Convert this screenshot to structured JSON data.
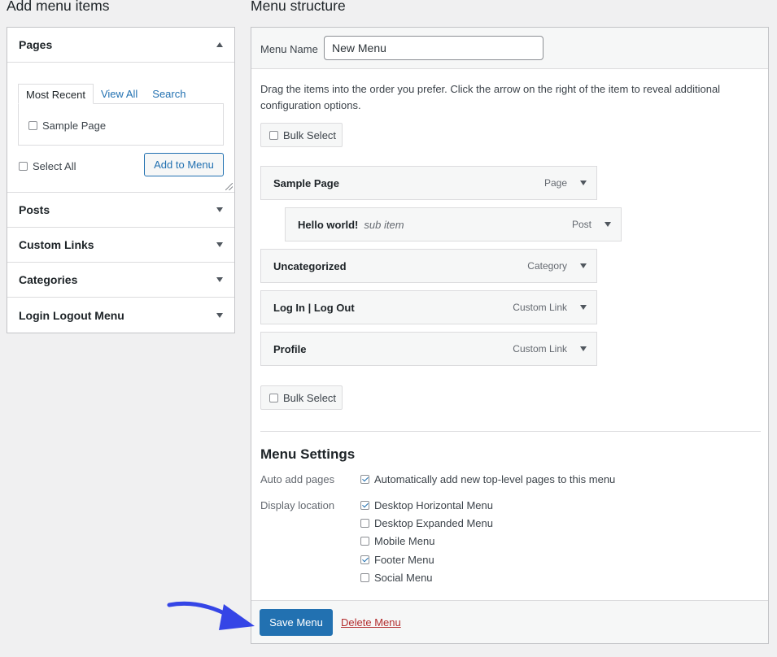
{
  "left_panel": {
    "title": "Add menu items",
    "pages_heading": "Pages",
    "tabs": [
      "Most Recent",
      "View All",
      "Search"
    ],
    "page_items": [
      "Sample Page"
    ],
    "select_all_label": "Select All",
    "add_button_label": "Add to Menu",
    "sections": [
      "Posts",
      "Custom Links",
      "Categories",
      "Login Logout Menu"
    ]
  },
  "right_panel": {
    "title": "Menu structure",
    "menu_name_label": "Menu Name",
    "menu_name_value": "New Menu",
    "instructions": "Drag the items into the order you prefer. Click the arrow on the right of the item to reveal additional configuration options.",
    "bulk_select_label": "Bulk Select",
    "menu_items": [
      {
        "title": "Sample Page",
        "sub": "",
        "type": "Page"
      },
      {
        "title": "Hello world!",
        "sub": "sub item",
        "type": "Post"
      },
      {
        "title": "Uncategorized",
        "sub": "",
        "type": "Category"
      },
      {
        "title": "Log In | Log Out",
        "sub": "",
        "type": "Custom Link"
      },
      {
        "title": "Profile",
        "sub": "",
        "type": "Custom Link"
      }
    ],
    "settings": {
      "title": "Menu Settings",
      "auto_add_label": "Auto add pages",
      "auto_add_option": {
        "label": "Automatically add new top-level pages to this menu",
        "checked": true
      },
      "display_location_label": "Display location",
      "locations": [
        {
          "label": "Desktop Horizontal Menu",
          "checked": true
        },
        {
          "label": "Desktop Expanded Menu",
          "checked": false
        },
        {
          "label": "Mobile Menu",
          "checked": false
        },
        {
          "label": "Footer Menu",
          "checked": true
        },
        {
          "label": "Social Menu",
          "checked": false
        }
      ]
    },
    "save_button_label": "Save Menu",
    "delete_link_label": "Delete Menu"
  },
  "colors": {
    "accent": "#2271b1",
    "danger": "#b32d2e",
    "annotation_arrow": "#3545e6"
  }
}
